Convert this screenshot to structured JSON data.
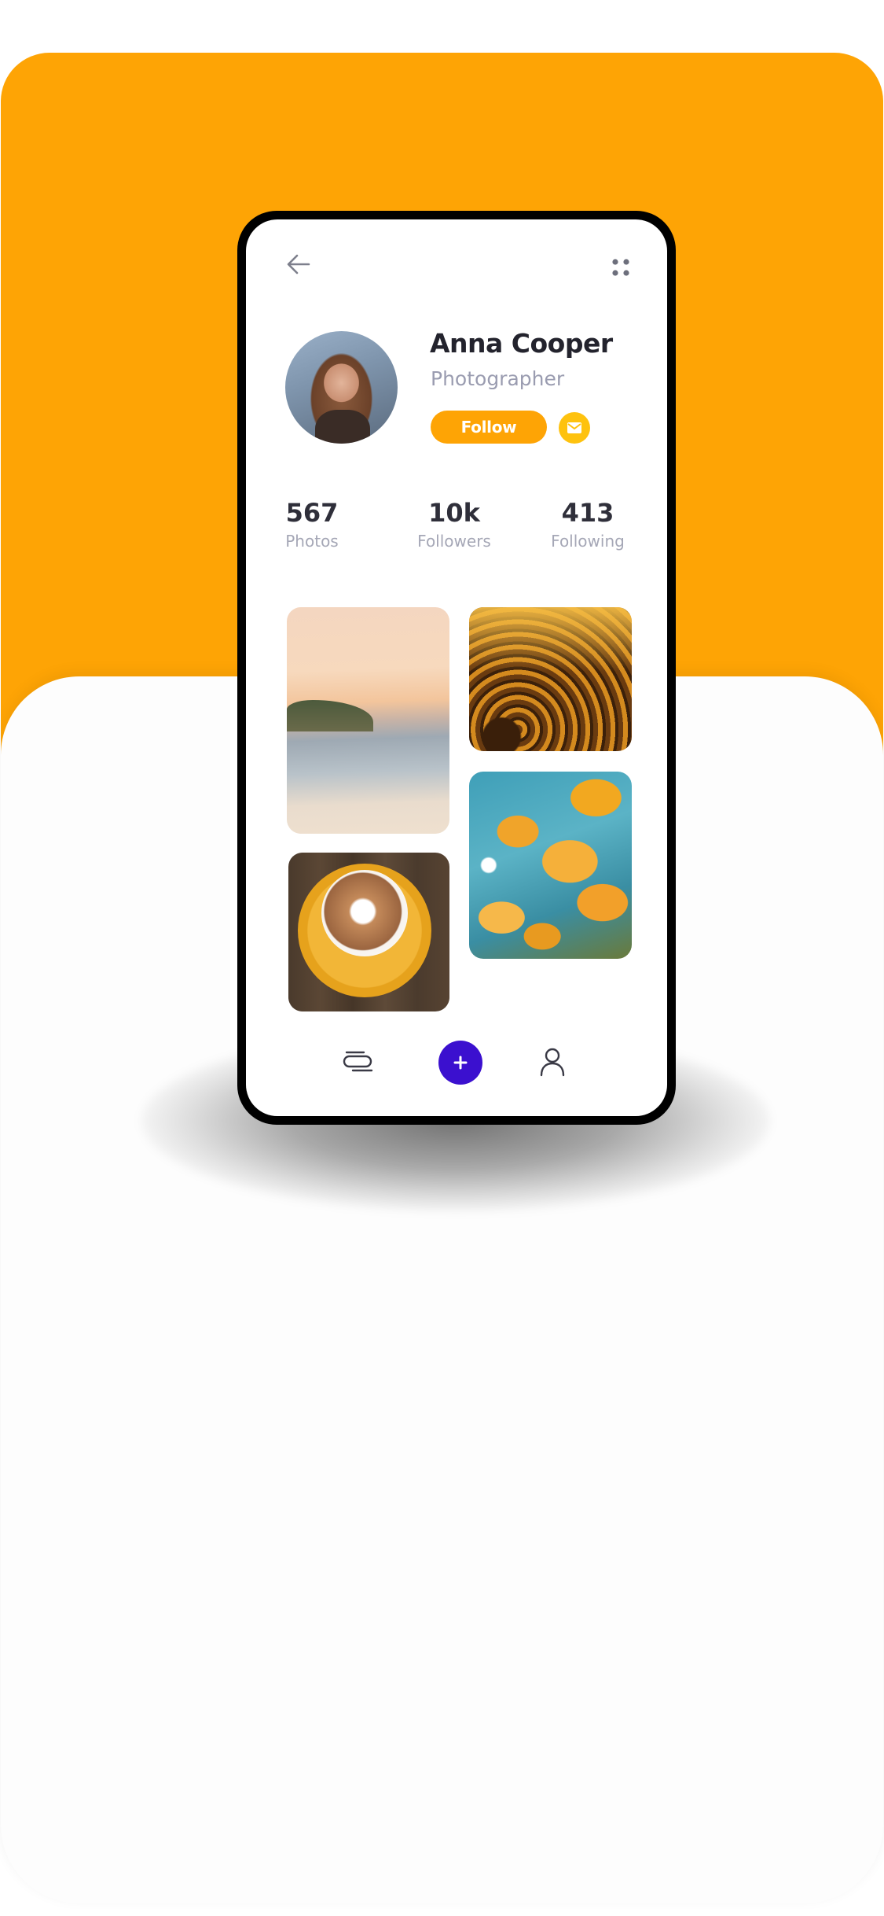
{
  "profile": {
    "name": "Anna Cooper",
    "role": "Photographer",
    "follow_label": "Follow"
  },
  "stats": [
    {
      "value": "567",
      "label": "Photos"
    },
    {
      "value": "10k",
      "label": "Followers"
    },
    {
      "value": "413",
      "label": "Following"
    }
  ],
  "icons": {
    "back": "arrow-left-icon",
    "menu": "grid-dots-icon",
    "mail": "mail-icon",
    "nav_list": "stack-icon",
    "nav_add": "plus-icon",
    "nav_user": "user-icon"
  },
  "colors": {
    "accent": "#fea405",
    "mail_button": "#fec20e",
    "add_button": "#3b10cf"
  }
}
